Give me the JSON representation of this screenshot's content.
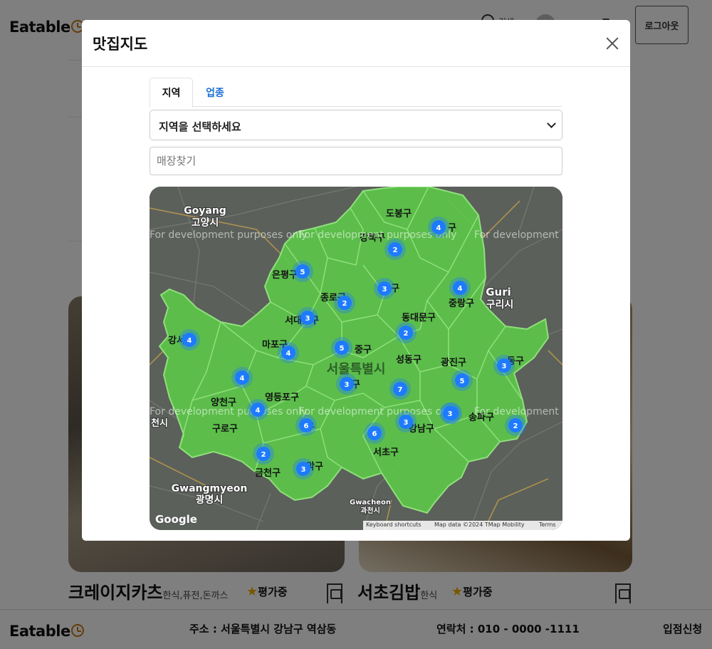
{
  "header": {
    "logo_text": "Eatable",
    "search_label": "검색",
    "logout_label": "로그아웃"
  },
  "cards": [
    {
      "name": "크레이지카츠",
      "category": "한식,퓨전,돈까스",
      "rating": "평가중"
    },
    {
      "name": "서초김밥",
      "category": "한식",
      "rating": "평가중"
    }
  ],
  "footer": {
    "logo_text": "Eatable",
    "address": "주소 : 서울특별시 강남구 역삼동",
    "contact": "연락처 : 010 - 0000 -1111",
    "apply": "입점신청"
  },
  "modal": {
    "title": "맛집지도",
    "tabs": [
      "지역",
      "업종"
    ],
    "active_tab": "지역",
    "region_select": "지역을 선택하세요",
    "store_search_placeholder": "매장찾기"
  },
  "map": {
    "watermark": "For development purposes only",
    "area_labels": {
      "goyang": "Goyang",
      "goyang_kr": "고양시",
      "guri": "Guri",
      "guri_kr": "구리시",
      "seoul_kr": "서울특별시",
      "gwangmyeong": "Gwangmyeon",
      "gwangmyeong_kr": "광명시",
      "gwacheon": "Gwacheon",
      "gwacheon_kr": "과천시",
      "bucheon_kr": "천시"
    },
    "districts": [
      {
        "id": "dobong",
        "name": "도봉구"
      },
      {
        "id": "gangbuk",
        "name": "강북구"
      },
      {
        "id": "eunpyeong",
        "name": "은평구"
      },
      {
        "id": "jongno",
        "name": "종로구"
      },
      {
        "id": "seongbuk",
        "name": "구"
      },
      {
        "id": "jungnang",
        "name": "중랑구"
      },
      {
        "id": "nowon",
        "name": "구"
      },
      {
        "id": "seodaemun",
        "name": "서대문구"
      },
      {
        "id": "dongdaemun",
        "name": "동대문구"
      },
      {
        "id": "gangseo",
        "name": "강서구"
      },
      {
        "id": "mapo",
        "name": "마포구"
      },
      {
        "id": "jung",
        "name": "중구"
      },
      {
        "id": "seongdong",
        "name": "성동구"
      },
      {
        "id": "gwangjin",
        "name": "광진구"
      },
      {
        "id": "gangdong",
        "name": "동구"
      },
      {
        "id": "yongsan",
        "name": "구"
      },
      {
        "id": "yeongdeungpo",
        "name": "영등포구"
      },
      {
        "id": "yangcheon",
        "name": "양천구"
      },
      {
        "id": "guro",
        "name": "구로구"
      },
      {
        "id": "dongjak",
        "name": "구"
      },
      {
        "id": "gangnam",
        "name": "강남구"
      },
      {
        "id": "songpa",
        "name": "송파구"
      },
      {
        "id": "seocho",
        "name": "서초구"
      },
      {
        "id": "geumcheon",
        "name": "금천구"
      },
      {
        "id": "gwanak",
        "name": "악구"
      }
    ],
    "clusters": [
      4,
      2,
      5,
      3,
      2,
      4,
      3,
      2,
      4,
      4,
      5,
      4,
      3,
      7,
      3,
      4,
      6,
      6,
      3,
      3,
      2,
      3,
      2,
      5,
      3
    ],
    "attribution": {
      "shortcuts": "Keyboard shortcuts",
      "data": "Map data ©2024 TMap Mobility",
      "terms": "Terms",
      "google": "Google"
    },
    "colors": {
      "district_fill": "#5cc54a",
      "district_stroke": "#8fe07a",
      "cluster": "#1e7bff",
      "base": "#5b605b"
    }
  }
}
